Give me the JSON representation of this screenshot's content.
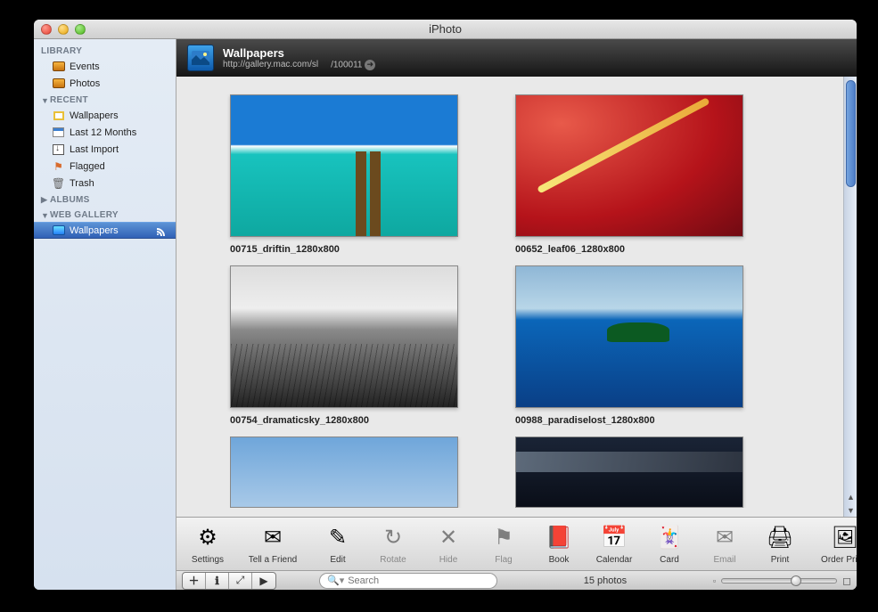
{
  "window": {
    "title": "iPhoto"
  },
  "sidebar": {
    "sections": [
      {
        "label": "LIBRARY",
        "collapsed": false,
        "items": [
          {
            "label": "Events",
            "icon": "events-icon"
          },
          {
            "label": "Photos",
            "icon": "photos-icon"
          }
        ]
      },
      {
        "label": "RECENT",
        "collapsed": false,
        "items": [
          {
            "label": "Wallpapers",
            "icon": "album-icon"
          },
          {
            "label": "Last 12 Months",
            "icon": "calendar-icon"
          },
          {
            "label": "Last Import",
            "icon": "import-icon"
          },
          {
            "label": "Flagged",
            "icon": "flag-icon"
          },
          {
            "label": "Trash",
            "icon": "trash-icon"
          }
        ]
      },
      {
        "label": "ALBUMS",
        "collapsed": true,
        "items": []
      },
      {
        "label": "WEB GALLERY",
        "collapsed": false,
        "items": [
          {
            "label": "Wallpapers",
            "icon": "gallery-icon",
            "selected": true,
            "rss": true
          }
        ]
      }
    ]
  },
  "header": {
    "title": "Wallpapers",
    "url": "http://gallery.mac.com/sl",
    "id_text": "/100011"
  },
  "photos": [
    {
      "label": "00715_driftin_1280x800",
      "thumb": "th1"
    },
    {
      "label": "00652_leaf06_1280x800",
      "thumb": "th2"
    },
    {
      "label": "00754_dramaticsky_1280x800",
      "thumb": "th3"
    },
    {
      "label": "00988_paradiselost_1280x800",
      "thumb": "th4"
    },
    {
      "label": "",
      "thumb": "th5"
    },
    {
      "label": "",
      "thumb": "th6"
    }
  ],
  "toolbar": {
    "items": [
      {
        "label": "Settings",
        "icon": "gear-icon",
        "glyph": "⚙"
      },
      {
        "label": "Tell a Friend",
        "icon": "mail-icon",
        "glyph": "✉",
        "wide": true
      },
      {
        "label": "Edit",
        "icon": "pencil-icon",
        "glyph": "✎"
      },
      {
        "label": "Rotate",
        "icon": "rotate-icon",
        "glyph": "↻",
        "dim": true
      },
      {
        "label": "Hide",
        "icon": "hide-icon",
        "glyph": "✕",
        "dim": true
      },
      {
        "label": "Flag",
        "icon": "flag-icon",
        "glyph": "⚑",
        "dim": true
      },
      {
        "label": "Book",
        "icon": "book-icon",
        "glyph": "📕"
      },
      {
        "label": "Calendar",
        "icon": "calendar-icon",
        "glyph": "📅"
      },
      {
        "label": "Card",
        "icon": "card-icon",
        "glyph": "🃏"
      },
      {
        "label": "Email",
        "icon": "email-icon",
        "glyph": "✉",
        "dim": true
      },
      {
        "label": "Print",
        "icon": "print-icon",
        "glyph": "🖨"
      },
      {
        "label": "Order Prints",
        "icon": "order-icon",
        "glyph": "🖼",
        "wide": true
      }
    ]
  },
  "statusbar": {
    "search_placeholder": "Search",
    "count_text": "15 photos"
  }
}
